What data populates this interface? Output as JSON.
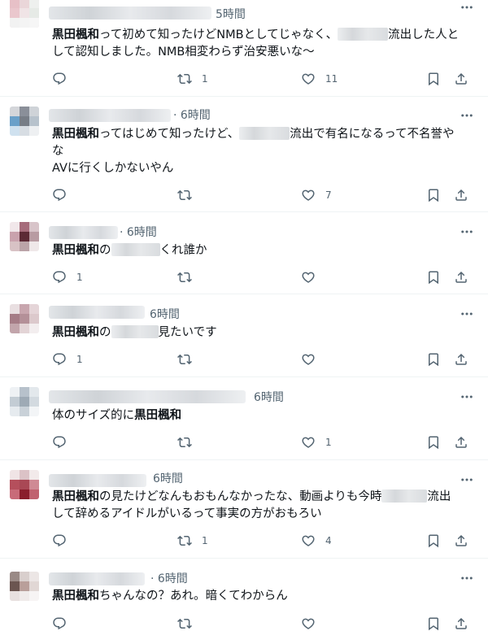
{
  "colors": {
    "text": "#0f1419",
    "muted": "#536471",
    "divider": "#eff3f4"
  },
  "icons": {
    "reply": "reply-icon",
    "retweet": "retweet-icon",
    "like": "like-icon",
    "bookmark": "bookmark-icon",
    "share": "share-icon",
    "more": "more-icon"
  },
  "posts": [
    {
      "time": "5時間",
      "line1": {
        "bold": "黒田楓和",
        "a": "って初めて知ったけどNMBとしてじゃなく、",
        "b": "流出した人と"
      },
      "line2": "して認知しました。NMB相変わらず治安悪いな〜",
      "replies": "",
      "retweets": "1",
      "likes": "11"
    },
    {
      "time": "· 6時間",
      "line1": {
        "bold": "黒田楓和",
        "a": "ってはじめて知ったけど、",
        "b": "流出で有名になるって不名誉や"
      },
      "line2": "な",
      "line3": "AVに行くしかないやん",
      "replies": "",
      "retweets": "",
      "likes": "7"
    },
    {
      "time": "· 6時間",
      "line1": {
        "bold": "黒田楓和",
        "a": "の",
        "b": "くれ誰か"
      },
      "replies": "1",
      "retweets": "",
      "likes": ""
    },
    {
      "time": "6時間",
      "line1": {
        "bold": "黒田楓和",
        "a": "の",
        "b": "見たいです"
      },
      "replies": "1",
      "retweets": "",
      "likes": ""
    },
    {
      "time": "6時間",
      "line1": {
        "a": "体のサイズ的に",
        "bold": "黒田楓和"
      },
      "replies": "",
      "retweets": "",
      "likes": "1"
    },
    {
      "time": "6時間",
      "line1": {
        "bold": "黒田楓和",
        "a": "の見たけどなんもおもんなかったな、動画よりも今時",
        "b": "流出"
      },
      "line2": "して辞めるアイドルがいるって事実の方がおもろい",
      "replies": "",
      "retweets": "1",
      "likes": "4"
    },
    {
      "time": "· 6時間",
      "line1": {
        "bold": "黒田楓和",
        "a": "ちゃんなの？あれ。暗くてわからん"
      },
      "replies": "",
      "retweets": "",
      "likes": ""
    }
  ]
}
